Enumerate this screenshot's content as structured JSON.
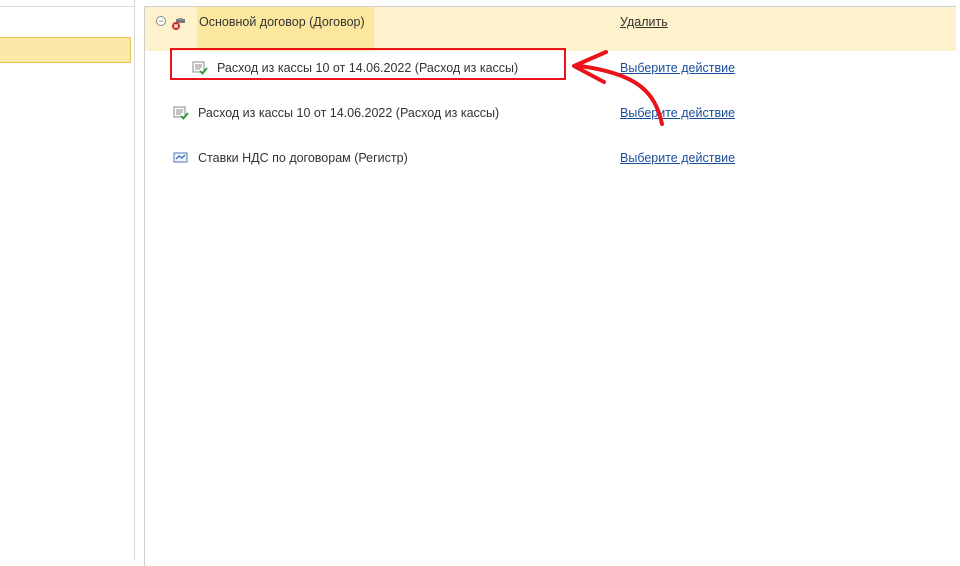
{
  "tree": {
    "parent": {
      "label": "Основной договор (Договор)",
      "action": "Удалить",
      "icon": "catalog-marked-deletion-icon"
    },
    "children": [
      {
        "label": "Расход из кассы 10 от 14.06.2022  (Расход из кассы)",
        "action": "Выберите действие",
        "icon": "posted-document-icon"
      },
      {
        "label": "Расход из кассы 10 от 14.06.2022  (Расход из кассы)",
        "action": "Выберите действие",
        "icon": "posted-document-icon"
      },
      {
        "label": "Ставки НДС по договорам (Регистр)",
        "action": "Выберите действие",
        "icon": "register-icon"
      }
    ]
  },
  "colors": {
    "highlight": "#e8141a",
    "link": "#1a4e9a",
    "selected_row": "#fce79e"
  }
}
